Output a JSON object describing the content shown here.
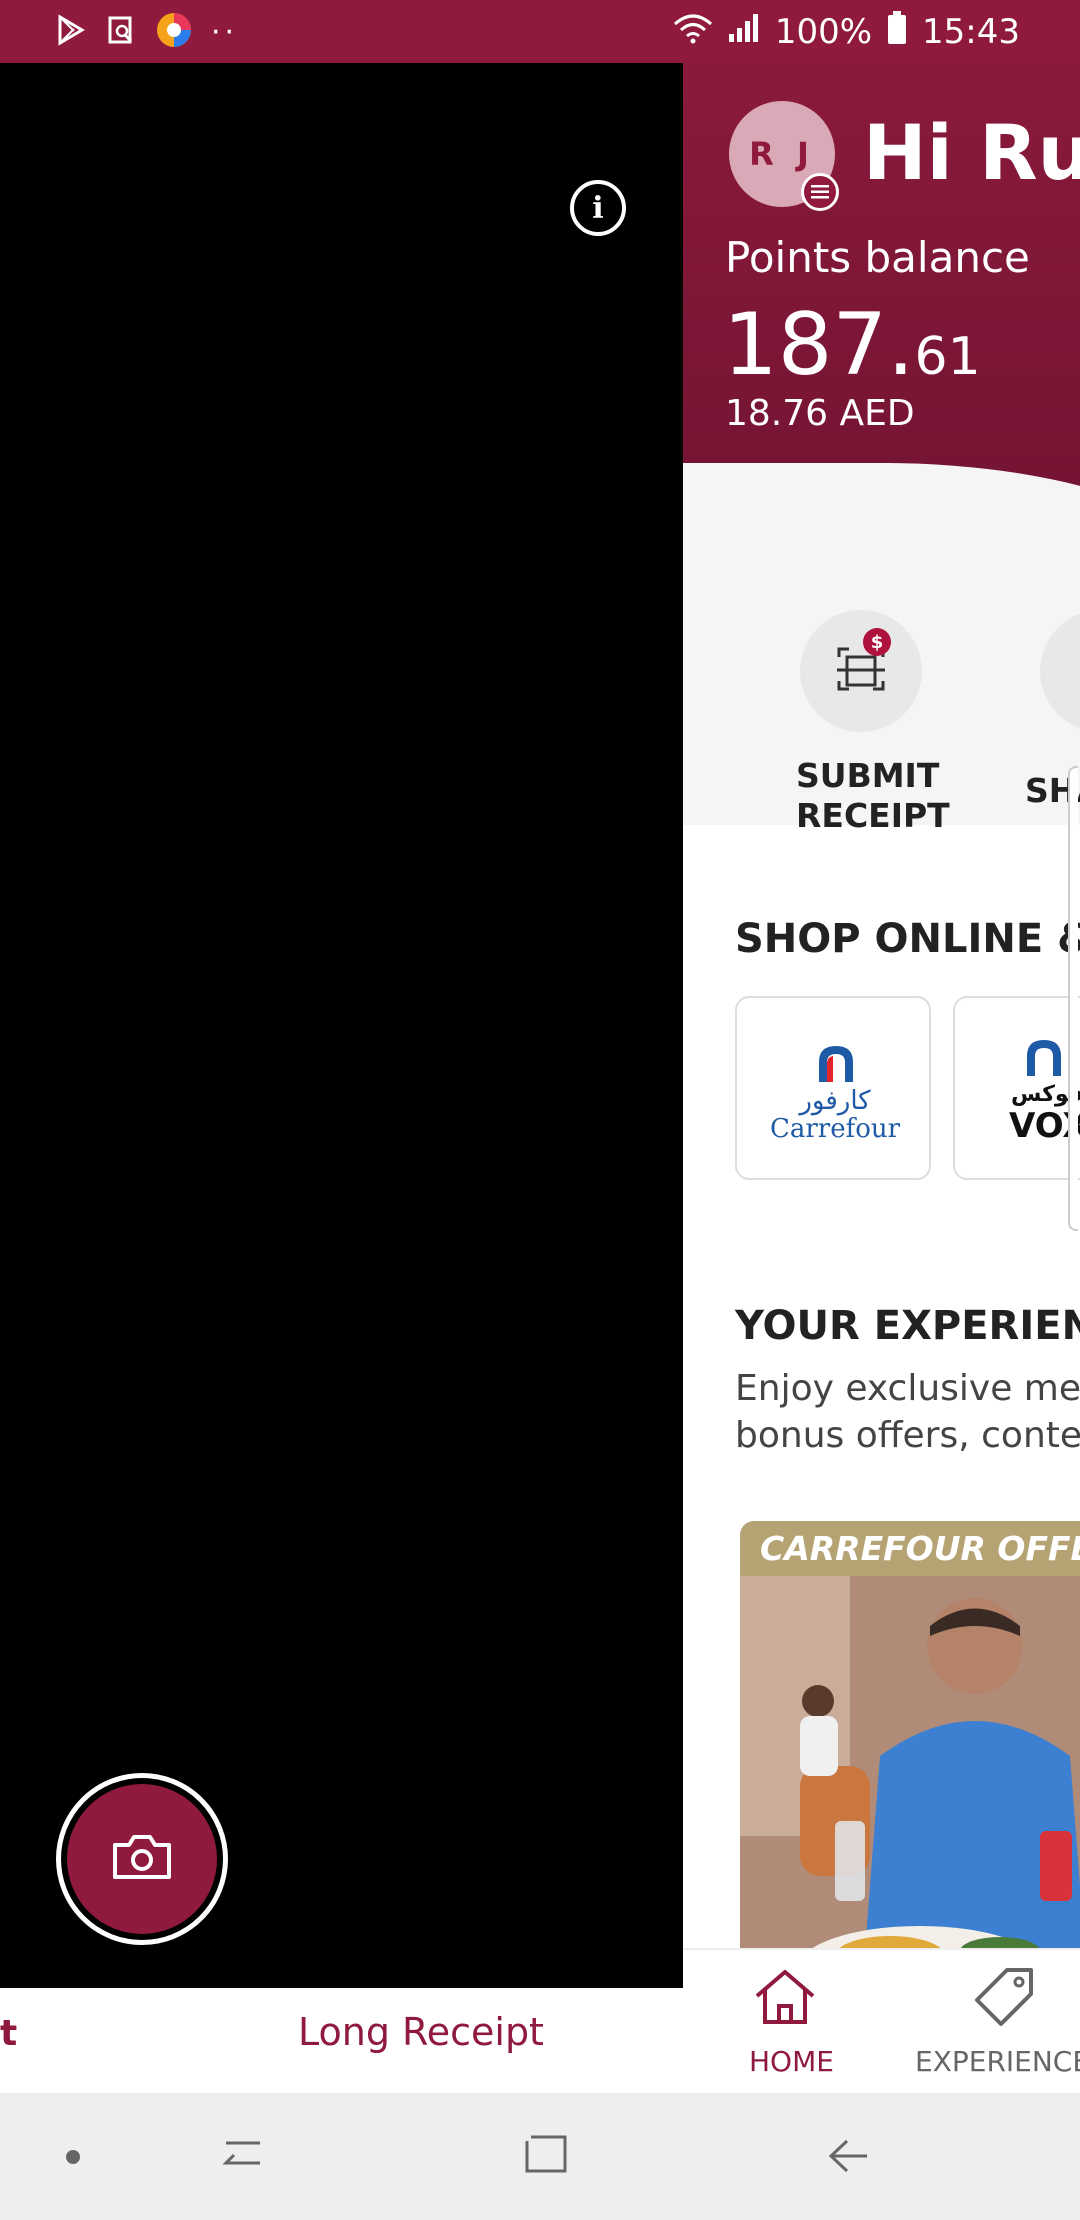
{
  "status_bar": {
    "battery": "100%",
    "time": "15:43",
    "icons": [
      "play-store-icon",
      "screenshot-icon",
      "browser-icon",
      "more-dots-icon",
      "wifi-icon",
      "signal-icon",
      "battery-icon"
    ]
  },
  "camera": {
    "info_icon": "info-icon",
    "capture_icon": "camera-icon",
    "tabs": [
      {
        "label": "t",
        "active": true
      },
      {
        "label": "Long Receipt",
        "active": false
      }
    ]
  },
  "app": {
    "avatar_initials": "R J",
    "greeting": "Hi Rus",
    "points_label": "Points balance",
    "points_integer": "187.",
    "points_decimal": "61",
    "points_aed": "18.76 AED",
    "actions": [
      {
        "line1": "SUBMIT",
        "line2": "RECEIPT",
        "icon": "receipt-scan-icon",
        "badge": "$"
      },
      {
        "line1": "SHA",
        "line2": "",
        "icon": "share-icon"
      }
    ],
    "shop_title": "SHOP ONLINE & E",
    "partners": [
      {
        "name_ar": "كارفور",
        "name_en": "Carrefour"
      },
      {
        "name_ar": "ڤوكس",
        "name_en": "VOX"
      }
    ],
    "experience_title": "YOUR EXPERIENC",
    "experience_desc_1": "Enjoy exclusive mer",
    "experience_desc_2": "bonus offers, contes",
    "offer_label": "CARREFOUR OFFERS",
    "nav": [
      {
        "label": "HOME",
        "icon": "home-icon",
        "active": true
      },
      {
        "label": "EXPERIENCE",
        "icon": "tag-icon",
        "active": false
      }
    ]
  },
  "colors": {
    "brand": "#8f1a3e",
    "background": "#f5f5f5"
  }
}
